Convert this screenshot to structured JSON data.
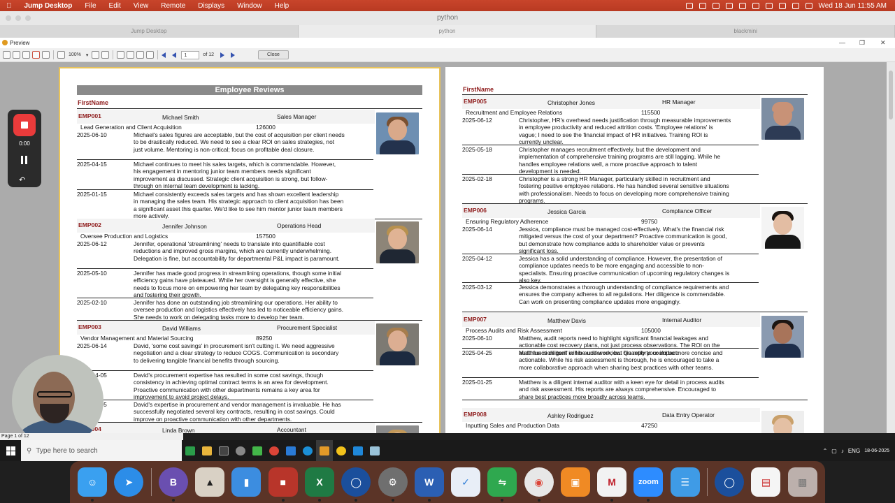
{
  "menubar": {
    "app": "Jump Desktop",
    "items": [
      "File",
      "Edit",
      "View",
      "Remote",
      "Displays",
      "Window",
      "Help"
    ],
    "clock": "Wed 18 Jun  11:55 AM"
  },
  "remote_title": "python",
  "tabs": [
    {
      "label": "Jump Desktop"
    },
    {
      "label": "python"
    },
    {
      "label": "blackmini"
    }
  ],
  "window": {
    "title": "Preview"
  },
  "toolbar": {
    "zoom": "100%",
    "page": "1",
    "page_total": "of 12",
    "close": "Close"
  },
  "report": {
    "title": "Employee Reviews",
    "col_head": "FirstName"
  },
  "left_employees": [
    {
      "id": "EMP001",
      "name": "Michael Smith",
      "title": "Sales Manager",
      "dept": "Lead Generation and Client Acquisition",
      "salary": "126000",
      "photo": {
        "skin": "#d9a98a",
        "hair": "#7a5030",
        "shirt": "#23324d",
        "bg": "#6e8fb2"
      },
      "reviews": [
        {
          "date": "2025-06-10",
          "text": "Michael's sales figures are acceptable, but the cost of acquisition per client needs to be drastically reduced. We need to see a clear ROI on sales strategies, not just volume. Mentoring is non-critical; focus on profitable deal closure."
        },
        {
          "date": "2025-04-15",
          "text": "Michael continues to meet his sales targets, which is commendable. However, his engagement in mentoring junior team members needs significant improvement as discussed. Strategic client acquisition is strong, but follow-through on internal team development is lacking."
        },
        {
          "date": "2025-01-15",
          "text": "Michael consistently exceeds sales targets and has shown excellent leadership in managing the sales team. His strategic approach to client acquisition has been a significant asset this quarter. We'd like to see him mentor junior team members more actively."
        }
      ]
    },
    {
      "id": "EMP002",
      "name": "Jennifer Johnson",
      "title": "Operations Head",
      "dept": "Oversee Production and Logistics",
      "salary": "157500",
      "photo": {
        "skin": "#e0b394",
        "hair": "#b8914e",
        "shirt": "#1f2733",
        "bg": "#8d8578"
      },
      "reviews": [
        {
          "date": "2025-06-12",
          "text": "Jennifer, operational 'streamlining' needs to translate into quantifiable cost reductions and improved gross margins, which are currently underwhelming. Delegation is fine, but accountability for departmental P&L impact is paramount."
        },
        {
          "date": "2025-05-10",
          "text": "Jennifer has made good progress in streamlining operations, though some initial efficiency gains have plateaued. While her oversight is generally effective, she needs to focus more on empowering her team by delegating key responsibilities and fostering their growth."
        },
        {
          "date": "2025-02-10",
          "text": "Jennifer has done an outstanding job streamlining our operations. Her ability to oversee production and logistics effectively has led to noticeable efficiency gains. She needs to work on delegating tasks more to develop her team."
        }
      ]
    },
    {
      "id": "EMP003",
      "name": "David Williams",
      "title": "Procurement Specialist",
      "dept": "Vendor Management and Material Sourcing",
      "salary": "89250",
      "photo": {
        "skin": "#dcae92",
        "hair": "#a77d4d",
        "shirt": "#1c2a40",
        "bg": "#7d7a73"
      },
      "reviews": [
        {
          "date": "2025-06-14",
          "text": "David, 'some cost savings' in procurement isn't cutting it. We need aggressive negotiation and a clear strategy to reduce COGS. Communication is secondary to delivering tangible financial benefits through sourcing."
        },
        {
          "date": "2025-04-05",
          "text": "David's procurement expertise has resulted in some cost savings, though consistency in achieving optimal contract terms is an area for development. Proactive communication with other departments remains a key area for improvement to avoid project delays."
        },
        {
          "date": "2025-01-05",
          "text": "David's expertise in procurement and vendor management is invaluable. He has successfully negotiated several key contracts, resulting in cost savings. Could improve on proactive communication with other departments."
        }
      ]
    },
    {
      "id": "EMP004",
      "name": "Linda Brown",
      "title": "Accountant",
      "dept": "",
      "salary": "",
      "photo": {
        "skin": "#e1b99b",
        "hair": "#c49a5a",
        "shirt": "#2c2c2c",
        "bg": "#8b8b8b"
      },
      "reviews": []
    }
  ],
  "right_employees": [
    {
      "id": "EMP005",
      "name": "Christopher Jones",
      "title": "HR Manager",
      "dept": "Recruitment and Employee Relations",
      "salary": "115500",
      "photo": {
        "skin": "#c89277",
        "hair": "#c89277",
        "shirt": "#2d3b55",
        "bg": "#7d8ea3"
      },
      "reviews": [
        {
          "date": "2025-06-12",
          "text": "Christopher, HR's overhead needs justification through measurable improvements in employee productivity and reduced attrition costs. 'Employee relations' is vague; I need to see the financial impact of HR initiatives. Training ROI is currently unclear."
        },
        {
          "date": "2025-05-18",
          "text": "Christopher manages recruitment effectively, but the development and implementation of comprehensive training programs are still lagging. While he handles employee relations well, a more proactive approach to talent development is needed."
        },
        {
          "date": "2025-02-18",
          "text": "Christopher is a strong HR Manager, particularly skilled in recruitment and fostering positive employee relations. He has handled several sensitive situations with professionalism. Needs to focus on developing more comprehensive training programs."
        }
      ]
    },
    {
      "id": "EMP006",
      "name": "Jessica Garcia",
      "title": "Compliance Officer",
      "dept": "Ensuring Regulatory Adherence",
      "salary": "99750",
      "photo": {
        "skin": "#e3bda3",
        "hair": "#1b1410",
        "shirt": "#161616",
        "bg": "#f4f4f4"
      },
      "reviews": [
        {
          "date": "2025-06-14",
          "text": "Jessica, compliance must be managed cost-effectively. What's the financial risk mitigated versus the cost of your department? Proactive communication is good, but demonstrate how compliance adds to shareholder value or prevents significant loss."
        },
        {
          "date": "2025-04-12",
          "text": "Jessica has a solid understanding of compliance. However, the presentation of compliance updates needs to be more engaging and accessible to non-specialists. Ensuring proactive communication of upcoming regulatory changes is also key."
        },
        {
          "date": "2025-03-12",
          "text": "Jessica demonstrates a thorough understanding of compliance requirements and ensures the company adheres to all regulations. Her diligence is commendable. Can work on presenting compliance updates more engagingly."
        }
      ]
    },
    {
      "id": "EMP007",
      "name": "Matthew Davis",
      "title": "Internal Auditor",
      "dept": "Process Audits and Risk Assessment",
      "salary": "105000",
      "photo": {
        "skin": "#a8745a",
        "hair": "#1c1512",
        "shirt": "#1d2d4a",
        "bg": "#8a9ab0"
      },
      "reviews": [
        {
          "date": "2025-06-10",
          "text": "Matthew, audit reports need to highlight significant financial leakages and actionable cost recovery plans, not just process observations. The ROI on the audit function itself will be under review. Quantify your impact."
        },
        {
          "date": "2025-04-25",
          "text": "Matthew is diligent in his audit work, but his reports could be more concise and actionable. While his risk assessment is thorough, he is encouraged to take a more collaborative approach when sharing best practices with other teams."
        },
        {
          "date": "2025-01-25",
          "text": "Matthew is a diligent internal auditor with a keen eye for detail in process audits and risk assessment. His reports are always comprehensive. Encouraged to share best practices more broadly across teams."
        }
      ]
    },
    {
      "id": "EMP008",
      "name": "Ashley Rodriguez",
      "title": "Data Entry Operator",
      "dept": "Inputting Sales and Production Data",
      "salary": "47250",
      "photo": {
        "skin": "#e4c0a4",
        "hair": "#c9a06a",
        "shirt": "#dcdcdc",
        "bg": "#eeeeee"
      },
      "reviews": []
    }
  ],
  "recorder": {
    "time": "0:00"
  },
  "statusbar": {
    "text": "Page 1 of 12"
  },
  "taskbar": {
    "search_placeholder": "Type here to search",
    "lang": "ENG",
    "date": "18-06-2025"
  }
}
